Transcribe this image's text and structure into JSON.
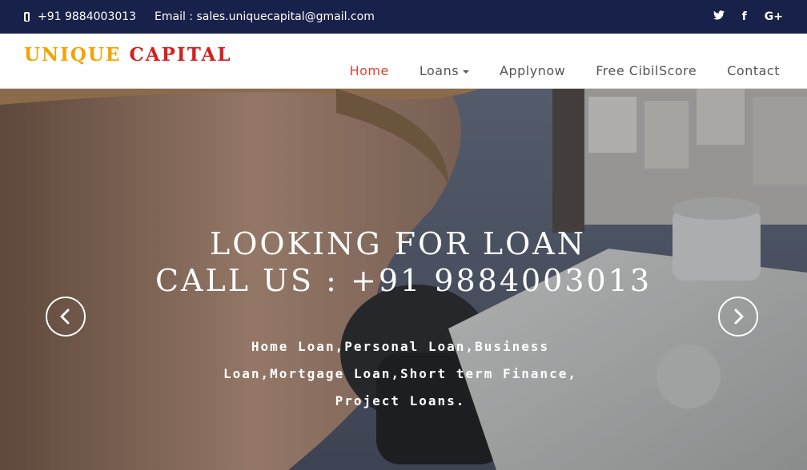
{
  "topbar": {
    "phone": "+91 9884003013",
    "email": "Email : sales.uniquecapital@gmail.com",
    "social": [
      "twitter-icon",
      "facebook-icon",
      "google-plus-icon"
    ],
    "social_glyphs": {
      "twitter": "🐦",
      "facebook": "f",
      "google_plus": "G+"
    },
    "bg_color": "#18214a"
  },
  "brand": {
    "word1": "UNIQUE",
    "word2": "CAPITAL",
    "color1": "#f5a300",
    "color2": "#d41f1f"
  },
  "nav": {
    "items": [
      "Home",
      "Loans",
      "Applynow",
      "Free CibilScore",
      "Contact"
    ],
    "active": "Home",
    "active_color": "#e5412d"
  },
  "hero": {
    "headline1": "LOOKING FOR LOAN",
    "headline2": "CALL US : +91 9884003013",
    "subtext": "Home Loan,Personal Loan,Business Loan,Mortgage Loan,Short term Finance, Project Loans.",
    "prev_icon": "chevron-left-icon",
    "next_icon": "chevron-right-icon"
  }
}
